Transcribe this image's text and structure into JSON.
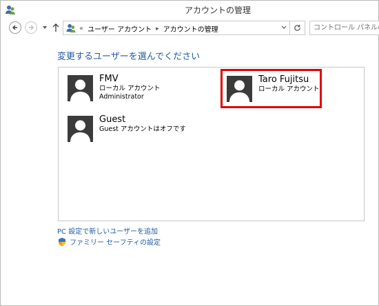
{
  "window": {
    "title": "アカウントの管理"
  },
  "address_bar": {
    "prefix": "«",
    "crumbs": [
      "ユーザー アカウント",
      "アカウントの管理"
    ],
    "separator": "▸"
  },
  "search": {
    "placeholder": "コントロール パネルの検索"
  },
  "main": {
    "heading": "変更するユーザーを選んでください",
    "accounts": [
      {
        "name": "FMV",
        "line1": "ローカル アカウント",
        "line2": "Administrator"
      },
      {
        "name": "Taro Fujitsu",
        "line1": "ローカル アカウント",
        "line2": ""
      },
      {
        "name": "Guest",
        "line1": "Guest アカウントはオフです",
        "line2": ""
      }
    ],
    "highlight_color": "#e00000",
    "link_color": "#1e5aa8"
  },
  "links": {
    "add_user": "PC 設定で新しいユーザーを追加",
    "family_safety": "ファミリー セーフティの設定"
  },
  "icons": {
    "app": "user-accounts-icon",
    "back": "back-arrow-icon",
    "forward": "forward-arrow-icon",
    "recent": "chevron-down-icon",
    "up": "up-arrow-icon",
    "refresh": "refresh-icon",
    "shield": "shield-icon"
  }
}
